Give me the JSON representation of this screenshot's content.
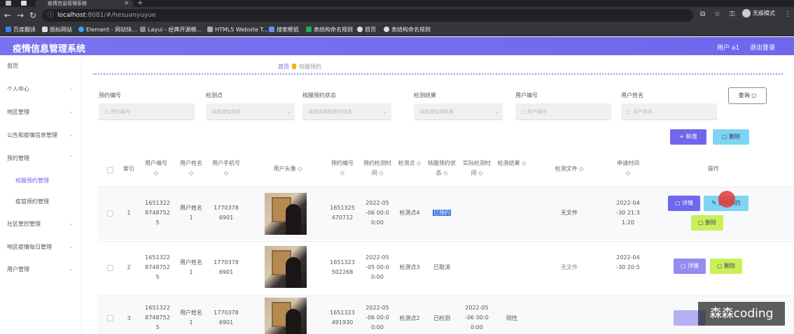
{
  "browser": {
    "tab_title": "疫情信息管理系统",
    "url_host": "localhost",
    "url_rest": ":8081/#/hesuanyuyue",
    "profile_label": "无痕模式",
    "bookmarks": [
      "百度翻译",
      "图标网站",
      "Element - 网站快...",
      "Layui - 经典开源模...",
      "HTML5 Website T...",
      "搜索壁纸",
      "表结构命名规则",
      "首页",
      "表结构命名规则"
    ]
  },
  "header": {
    "title": "疫情信息管理系统",
    "user": "用户 a1",
    "logout": "退出登录"
  },
  "sidebar": {
    "items": [
      "首页",
      "个人中心",
      "地区管理",
      "公告和疫情信息管理",
      "预约管理",
      "社区管控管理",
      "地区疫情每日管理",
      "用户管理"
    ],
    "subitems": [
      "核酸预约管理",
      "疫苗预约管理"
    ]
  },
  "breadcrumb": {
    "home": "首页",
    "current": "核酸预约"
  },
  "filters": {
    "labels": [
      "预约编号",
      "检测点",
      "核酸预约状态",
      "检测结果",
      "用户编号",
      "用户姓名"
    ],
    "placeholders": [
      "预约编号",
      "请选择检测点",
      "请选择核酸预约状态",
      "请选择检测结果",
      "用户编号",
      "用户姓名"
    ],
    "query_btn": "查询 ○"
  },
  "toolbar": {
    "add": "+ 新增",
    "delete": "删除"
  },
  "table": {
    "headers": [
      "索引",
      "用户编号 ◇",
      "用户姓名 ◇",
      "用户手机号 ◇",
      "用户头像 ◇",
      "预约编号 ◇",
      "预约检测时间 ◇",
      "检测点 ◇",
      "核酸预约状态 ◇",
      "实际检测时间 ◇",
      "检测结果 ◇",
      "检测文件 ◇",
      "申请时间 ◇",
      "操作"
    ],
    "rows": [
      {
        "index": "1",
        "user_no": "1651322 8748752 5",
        "user_name": "用户姓名 1",
        "phone": "1770378 6901",
        "order_no": "1651325 470712",
        "order_time": "2022-05 -06 00:0 0:00",
        "site": "检测点4",
        "status": "已预约",
        "actual_time": "",
        "result": "",
        "file": "无文件",
        "apply_time": "2022-04 -30 21:3 1:20",
        "btn_detail": "详情",
        "btn_mid": "更改预约",
        "btn_del": "删除"
      },
      {
        "index": "2",
        "user_no": "1651322 8748752 5",
        "user_name": "用户姓名 1",
        "phone": "1770378 6901",
        "order_no": "1651323 502268",
        "order_time": "2022-05 -05 00:0 0:00",
        "site": "检测点3",
        "status": "已取消",
        "actual_time": "",
        "result": "",
        "file": "无文件",
        "apply_time": "2022-04 -30 20:5",
        "btn_detail": "详情",
        "btn_del": "删除"
      },
      {
        "index": "3",
        "user_no": "1651322 8748752 5",
        "user_name": "用户姓名 1",
        "phone": "1770378 6901",
        "order_no": "1651323 491930",
        "order_time": "2022-05 -06 00:0 0:00",
        "site": "检测点2",
        "status": "已检测",
        "actual_time": "2022-05 -06 00:0 0:00",
        "result": "阳性",
        "file": "",
        "apply_time": "",
        "btn_detail": ""
      }
    ]
  },
  "watermark": "森森coding"
}
